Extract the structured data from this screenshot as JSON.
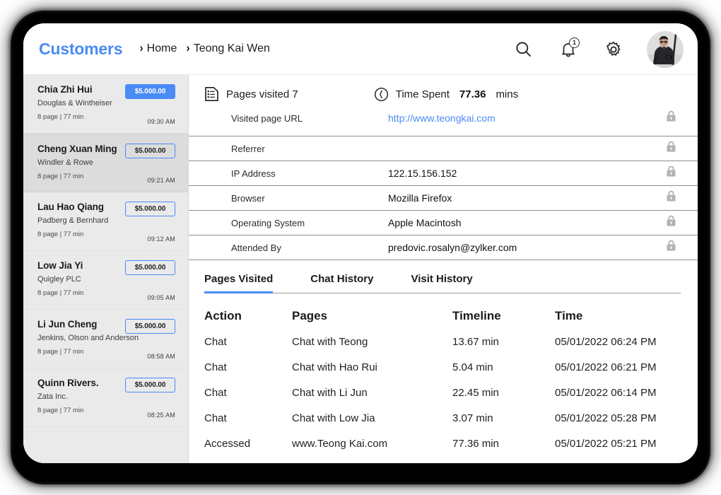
{
  "header": {
    "brand": "Customers",
    "breadcrumb": [
      {
        "label": "Home"
      },
      {
        "label": "Teong Kai Wen"
      }
    ],
    "separator": "›",
    "notification_count": "1",
    "icons": {
      "search": "search-icon",
      "bell": "bell-icon",
      "gear": "gear-icon",
      "avatar": "avatar"
    }
  },
  "sidebar": {
    "customers": [
      {
        "name": "Chia Zhi Hui",
        "company": "Douglas & Wintheiser",
        "meta": "8 page | 77 min",
        "amount": "$5.000.00",
        "time": "09:30 AM",
        "amount_filled": true,
        "selected": false
      },
      {
        "name": "Cheng Xuan Ming",
        "company": "Windler & Rowe",
        "meta": "8 page | 77 min",
        "amount": "$5.000.00",
        "time": "09:21 AM",
        "amount_filled": false,
        "selected": true
      },
      {
        "name": "Lau Hao Qiang",
        "company": "Padberg & Bernhard",
        "meta": "8 page | 77 min",
        "amount": "$5.000.00",
        "time": "09:12 AM",
        "amount_filled": false,
        "selected": false
      },
      {
        "name": "Low Jia Yi",
        "company": "Quigley PLC",
        "meta": "8 page | 77 min",
        "amount": "$5.000.00",
        "time": "09:05 AM",
        "amount_filled": false,
        "selected": false
      },
      {
        "name": "Li Jun Cheng",
        "company": "Jenkins, Olson and Anderson",
        "meta": "8 page | 77 min",
        "amount": "$5.000.00",
        "time": "08:58 AM",
        "amount_filled": false,
        "selected": false
      },
      {
        "name": "Quinn Rivers.",
        "company": "Zata Inc.",
        "meta": "8 page | 77 min",
        "amount": "$5.000.00",
        "time": "08:25 AM",
        "amount_filled": false,
        "selected": false
      }
    ]
  },
  "detail": {
    "pages_visited_label": "Pages visited 7",
    "time_spent_label": "Time Spent",
    "time_spent_value": "77.36",
    "time_spent_unit": "mins",
    "url_label": "Visited page URL",
    "url_value": "http://www.teongkai.com",
    "info_rows": [
      {
        "label": "Referrer",
        "value": ""
      },
      {
        "label": "IP Address",
        "value": "122.15.156.152"
      },
      {
        "label": "Browser",
        "value": "Mozilla Firefox"
      },
      {
        "label": "Operating System",
        "value": "Apple Macintosh"
      },
      {
        "label": "Attended By",
        "value": "predovic.rosalyn@zylker.com"
      }
    ],
    "tabs": [
      {
        "label": "Pages Visited",
        "active": true
      },
      {
        "label": "Chat History",
        "active": false
      },
      {
        "label": "Visit History",
        "active": false
      }
    ],
    "table": {
      "columns": [
        "Action",
        "Pages",
        "Timeline",
        "Time"
      ],
      "rows": [
        {
          "action": "Chat",
          "pages": "Chat with Teong",
          "timeline": "13.67 min",
          "time": "05/01/2022 06:24 PM"
        },
        {
          "action": "Chat",
          "pages": "Chat with Hao Rui",
          "timeline": "5.04 min",
          "time": "05/01/2022 06:21 PM"
        },
        {
          "action": "Chat",
          "pages": "Chat with Li Jun",
          "timeline": "22.45 min",
          "time": "05/01/2022 06:14 PM"
        },
        {
          "action": "Chat",
          "pages": "Chat with Low Jia",
          "timeline": "3.07 min",
          "time": "05/01/2022 05:28 PM"
        },
        {
          "action": "Accessed",
          "pages": "www.Teong Kai.com",
          "timeline": "77.36 min",
          "time": "05/01/2022 05:21 PM"
        }
      ]
    }
  },
  "colors": {
    "accent": "#4a8bf5",
    "sidebar_bg": "#eaeaea",
    "sidebar_selected": "#dcdcdc",
    "frame": "#000000",
    "text": "#1b1b1b",
    "lock": "#b3b3b3"
  }
}
